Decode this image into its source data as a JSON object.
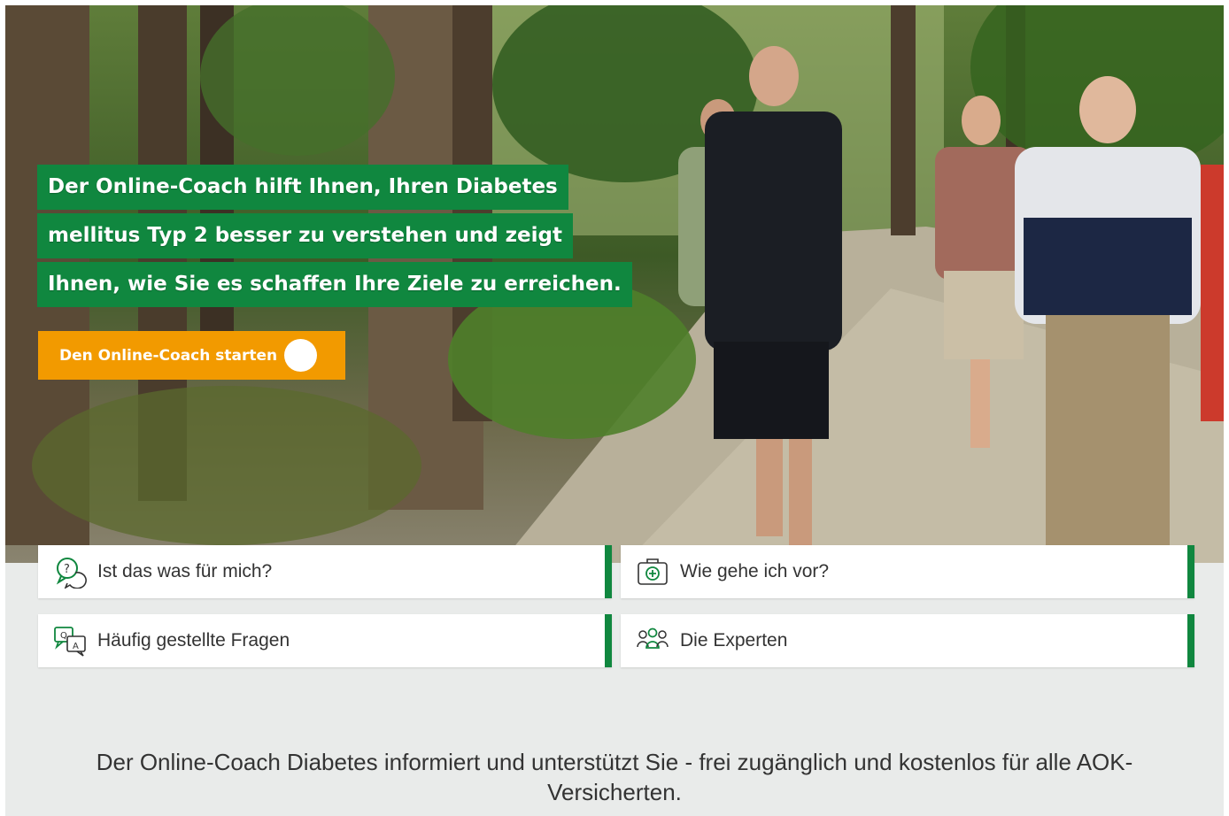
{
  "hero": {
    "image_alt": "Gruppe beim Nordic Walking im Wald",
    "headline_lines": [
      "Der Online-Coach hilft Ihnen, Ihren Diabetes",
      "mellitus Typ 2 besser zu verstehen und zeigt",
      "Ihnen, wie Sie es schaffen Ihre Ziele zu erreichen."
    ],
    "cta_label": "Den Online-Coach starten"
  },
  "nav": {
    "items": [
      {
        "label": "Ist das was für mich?",
        "icon": "question-bubble-icon"
      },
      {
        "label": "Wie gehe ich vor?",
        "icon": "first-aid-kit-icon"
      },
      {
        "label": "Häufig gestellte Fragen",
        "icon": "qa-bubbles-icon"
      },
      {
        "label": "Die Experten",
        "icon": "people-group-icon"
      }
    ]
  },
  "info": {
    "text": "Der Online-Coach Diabetes informiert und unterstützt Sie - frei zugänglich und kostenlos für alle AOK-Versicherten."
  },
  "colors": {
    "green": "#10873f",
    "orange": "#f29a00",
    "background": "#e9ebea"
  }
}
